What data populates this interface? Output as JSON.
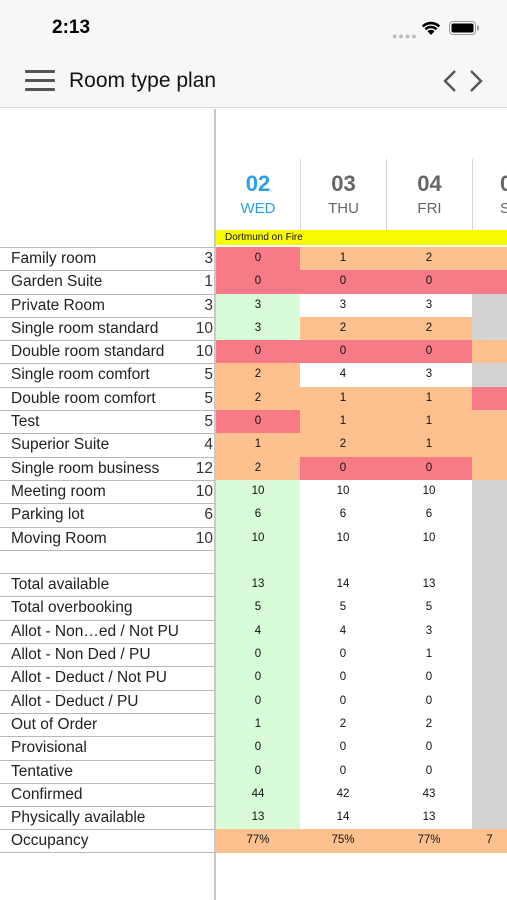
{
  "status_bar": {
    "time": "2:13"
  },
  "header": {
    "title": "Room type plan"
  },
  "days": [
    {
      "num": "02",
      "dow": "WED",
      "today": true
    },
    {
      "num": "03",
      "dow": "THU",
      "today": false
    },
    {
      "num": "04",
      "dow": "FRI",
      "today": false
    },
    {
      "num": "0",
      "dow": "S",
      "today": false
    }
  ],
  "event": {
    "label": "Dortmund on Fire"
  },
  "colors": {
    "overbooked_red": "#f77b86",
    "low_orange": "#fdc18f",
    "today_green": "#d8fbd8",
    "weekend_grey": "#d3d3d3",
    "event_yellow": "#fbfb00",
    "today_blue": "#2aa0e6"
  },
  "room_types": [
    {
      "name": "Family room",
      "count": "3",
      "values": [
        "0",
        "1",
        "2",
        ""
      ],
      "colors": [
        "red",
        "orange",
        "orange",
        "orange"
      ]
    },
    {
      "name": "Garden Suite",
      "count": "1",
      "values": [
        "0",
        "0",
        "0",
        ""
      ],
      "colors": [
        "red",
        "red",
        "red",
        "red"
      ]
    },
    {
      "name": "Private Room",
      "count": "3",
      "values": [
        "3",
        "3",
        "3",
        ""
      ],
      "colors": [
        "green",
        "white",
        "white",
        "grey"
      ]
    },
    {
      "name": "Single room standard",
      "count": "10",
      "values": [
        "3",
        "2",
        "2",
        ""
      ],
      "colors": [
        "green",
        "orange",
        "orange",
        "grey"
      ]
    },
    {
      "name": "Double room standard",
      "count": "10",
      "values": [
        "0",
        "0",
        "0",
        ""
      ],
      "colors": [
        "red",
        "red",
        "red",
        "orange"
      ]
    },
    {
      "name": "Single room comfort",
      "count": "5",
      "values": [
        "2",
        "4",
        "3",
        ""
      ],
      "colors": [
        "orange",
        "white",
        "white",
        "grey"
      ]
    },
    {
      "name": "Double room comfort",
      "count": "5",
      "values": [
        "2",
        "1",
        "1",
        ""
      ],
      "colors": [
        "orange",
        "orange",
        "orange",
        "red"
      ]
    },
    {
      "name": "Test",
      "count": "5",
      "values": [
        "0",
        "1",
        "1",
        ""
      ],
      "colors": [
        "red",
        "orange",
        "orange",
        "orange"
      ]
    },
    {
      "name": "Superior Suite",
      "count": "4",
      "values": [
        "1",
        "2",
        "1",
        ""
      ],
      "colors": [
        "orange",
        "orange",
        "orange",
        "orange"
      ]
    },
    {
      "name": "Single room business",
      "count": "12",
      "values": [
        "2",
        "0",
        "0",
        ""
      ],
      "colors": [
        "orange",
        "red",
        "red",
        "orange"
      ]
    },
    {
      "name": "Meeting room",
      "count": "10",
      "values": [
        "10",
        "10",
        "10",
        ""
      ],
      "colors": [
        "green",
        "white",
        "white",
        "grey"
      ]
    },
    {
      "name": "Parking lot",
      "count": "6",
      "values": [
        "6",
        "6",
        "6",
        ""
      ],
      "colors": [
        "green",
        "white",
        "white",
        "grey"
      ]
    },
    {
      "name": "Moving Room",
      "count": "10",
      "values": [
        "10",
        "10",
        "10",
        ""
      ],
      "colors": [
        "green",
        "white",
        "white",
        "grey"
      ]
    }
  ],
  "summary": [
    {
      "name": "Total available",
      "values": [
        "13",
        "14",
        "13",
        ""
      ],
      "colors": [
        "green",
        "white",
        "white",
        "grey"
      ]
    },
    {
      "name": "Total overbooking",
      "values": [
        "5",
        "5",
        "5",
        ""
      ],
      "colors": [
        "green",
        "white",
        "white",
        "grey"
      ]
    },
    {
      "name": "Allot - Non…ed / Not PU",
      "values": [
        "4",
        "4",
        "3",
        ""
      ],
      "colors": [
        "green",
        "white",
        "white",
        "grey"
      ]
    },
    {
      "name": "Allot - Non Ded / PU",
      "values": [
        "0",
        "0",
        "1",
        ""
      ],
      "colors": [
        "green",
        "white",
        "white",
        "grey"
      ]
    },
    {
      "name": "Allot - Deduct / Not PU",
      "values": [
        "0",
        "0",
        "0",
        ""
      ],
      "colors": [
        "green",
        "white",
        "white",
        "grey"
      ]
    },
    {
      "name": "Allot - Deduct / PU",
      "values": [
        "0",
        "0",
        "0",
        ""
      ],
      "colors": [
        "green",
        "white",
        "white",
        "grey"
      ]
    },
    {
      "name": "Out of Order",
      "values": [
        "1",
        "2",
        "2",
        ""
      ],
      "colors": [
        "green",
        "white",
        "white",
        "grey"
      ]
    },
    {
      "name": "Provisional",
      "values": [
        "0",
        "0",
        "0",
        ""
      ],
      "colors": [
        "green",
        "white",
        "white",
        "grey"
      ]
    },
    {
      "name": "Tentative",
      "values": [
        "0",
        "0",
        "0",
        ""
      ],
      "colors": [
        "green",
        "white",
        "white",
        "grey"
      ]
    },
    {
      "name": "Confirmed",
      "values": [
        "44",
        "42",
        "43",
        ""
      ],
      "colors": [
        "green",
        "white",
        "white",
        "grey"
      ]
    },
    {
      "name": "Physically available",
      "values": [
        "13",
        "14",
        "13",
        ""
      ],
      "colors": [
        "green",
        "white",
        "white",
        "grey"
      ]
    },
    {
      "name": "Occupancy",
      "values": [
        "77%",
        "75%",
        "77%",
        "7"
      ],
      "colors": [
        "orange",
        "orange",
        "orange",
        "orange"
      ]
    }
  ]
}
